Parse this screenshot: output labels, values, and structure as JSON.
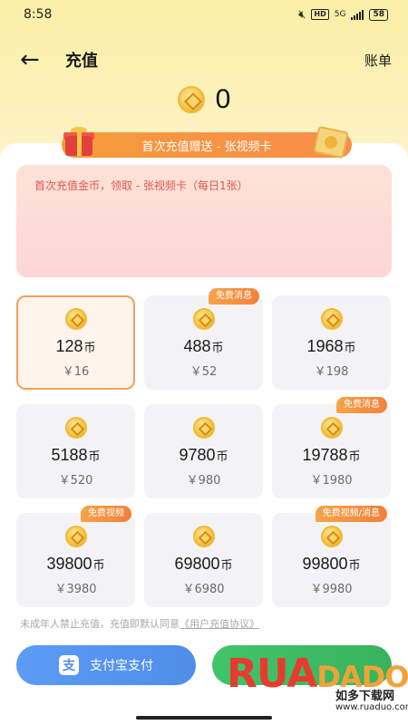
{
  "status": {
    "time": "8:58",
    "net": "5G",
    "battery": "58"
  },
  "nav": {
    "title": "充值",
    "bill": "账单"
  },
  "balance": {
    "value": "0"
  },
  "promo": {
    "ribbon": "首次充值赠送 - 张视频卡",
    "text": "首次充值金币，领取 - 张视频卡（每日1张）"
  },
  "packages": [
    {
      "coins": "128",
      "unit": "币",
      "price": "￥16",
      "badge": "",
      "selected": true
    },
    {
      "coins": "488",
      "unit": "币",
      "price": "￥52",
      "badge": "免费消息",
      "selected": false
    },
    {
      "coins": "1968",
      "unit": "币",
      "price": "￥198",
      "badge": "",
      "selected": false
    },
    {
      "coins": "5188",
      "unit": "币",
      "price": "￥520",
      "badge": "",
      "selected": false
    },
    {
      "coins": "9780",
      "unit": "币",
      "price": "￥980",
      "badge": "",
      "selected": false
    },
    {
      "coins": "19788",
      "unit": "币",
      "price": "￥1980",
      "badge": "免费消息",
      "selected": false
    },
    {
      "coins": "39800",
      "unit": "币",
      "price": "￥3980",
      "badge": "免费视频",
      "selected": false
    },
    {
      "coins": "69800",
      "unit": "币",
      "price": "￥6980",
      "badge": "",
      "selected": false
    },
    {
      "coins": "99800",
      "unit": "币",
      "price": "￥9980",
      "badge": "免费视频/消息",
      "selected": false
    }
  ],
  "agreement": {
    "prefix": "未成年人禁止充值，充值即默认同意",
    "link": "《用户充值协议》"
  },
  "pay": {
    "alipay_label": "支付宝支付",
    "alipay_icon": "支"
  },
  "watermark": {
    "letters": [
      "R",
      "U",
      "A",
      "D",
      "A",
      "D",
      "O"
    ],
    "cn": "如多下载网",
    "url": "www.ruaduo.com"
  }
}
